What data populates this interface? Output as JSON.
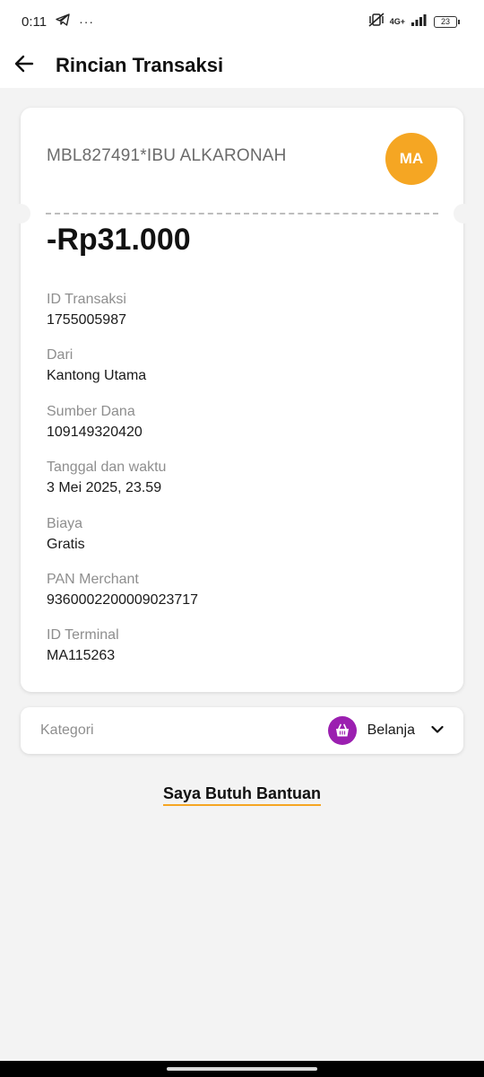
{
  "status_bar": {
    "time": "0:11",
    "network": "4G+",
    "battery": "23",
    "icons": [
      "telegram-icon",
      "more-dots-icon",
      "vibrate-off-icon",
      "signal-icon",
      "battery-icon"
    ]
  },
  "header": {
    "title": "Rincian Transaksi",
    "back_icon": "arrow-left-icon"
  },
  "transaction": {
    "merchant": "MBL827491*IBU ALKARONAH",
    "avatar_initials": "MA",
    "amount": "-Rp31.000",
    "details": [
      {
        "label": "ID Transaksi",
        "value": "1755005987"
      },
      {
        "label": "Dari",
        "value": "Kantong Utama"
      },
      {
        "label": "Sumber Dana",
        "value": "109149320420"
      },
      {
        "label": "Tanggal dan waktu",
        "value": "3 Mei 2025, 23.59"
      },
      {
        "label": "Biaya",
        "value": "Gratis"
      },
      {
        "label": "PAN Merchant",
        "value": "9360002200009023717"
      },
      {
        "label": "ID Terminal",
        "value": "MA115263"
      }
    ]
  },
  "category": {
    "label": "Kategori",
    "value": "Belanja",
    "icon": "shopping-basket-icon"
  },
  "help": {
    "label": "Saya Butuh Bantuan"
  },
  "colors": {
    "accent": "#f5a623",
    "category_icon_bg": "#9b1fb0",
    "background": "#f3f3f3"
  }
}
